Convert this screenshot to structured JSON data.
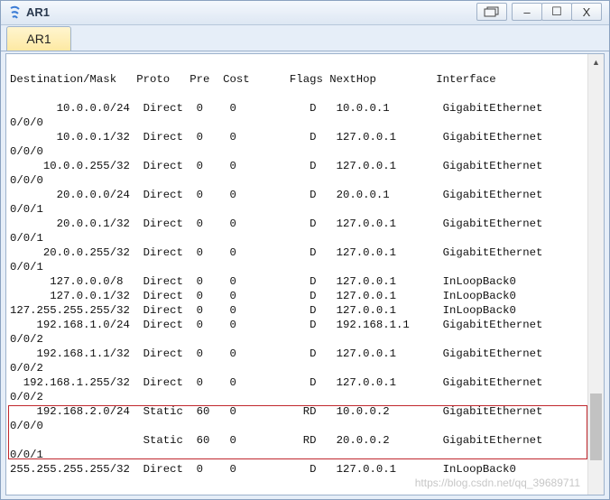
{
  "window": {
    "title": "AR1"
  },
  "tab": {
    "label": "AR1"
  },
  "controls": {
    "restore": "",
    "minimize": "–",
    "maximize": "☐",
    "close": "X"
  },
  "scroll_up": "▲",
  "watermark": "https://blog.csdn.net/qq_39689711",
  "console_lines": [
    "Destination/Mask   Proto   Pre  Cost      Flags NextHop         Interface",
    "",
    "       10.0.0.0/24  Direct  0    0           D   10.0.0.1        GigabitEthernet",
    "0/0/0",
    "       10.0.0.1/32  Direct  0    0           D   127.0.0.1       GigabitEthernet",
    "0/0/0",
    "     10.0.0.255/32  Direct  0    0           D   127.0.0.1       GigabitEthernet",
    "0/0/0",
    "       20.0.0.0/24  Direct  0    0           D   20.0.0.1        GigabitEthernet",
    "0/0/1",
    "       20.0.0.1/32  Direct  0    0           D   127.0.0.1       GigabitEthernet",
    "0/0/1",
    "     20.0.0.255/32  Direct  0    0           D   127.0.0.1       GigabitEthernet",
    "0/0/1",
    "      127.0.0.0/8   Direct  0    0           D   127.0.0.1       InLoopBack0",
    "      127.0.0.1/32  Direct  0    0           D   127.0.0.1       InLoopBack0",
    "127.255.255.255/32  Direct  0    0           D   127.0.0.1       InLoopBack0",
    "    192.168.1.0/24  Direct  0    0           D   192.168.1.1     GigabitEthernet",
    "0/0/2",
    "    192.168.1.1/32  Direct  0    0           D   127.0.0.1       GigabitEthernet",
    "0/0/2",
    "  192.168.1.255/32  Direct  0    0           D   127.0.0.1       GigabitEthernet",
    "0/0/2",
    "    192.168.2.0/24  Static  60   0          RD   10.0.0.2        GigabitEthernet",
    "0/0/0",
    "                    Static  60   0          RD   20.0.0.2        GigabitEthernet",
    "0/0/1",
    "255.255.255.255/32  Direct  0    0           D   127.0.0.1       InLoopBack0"
  ]
}
